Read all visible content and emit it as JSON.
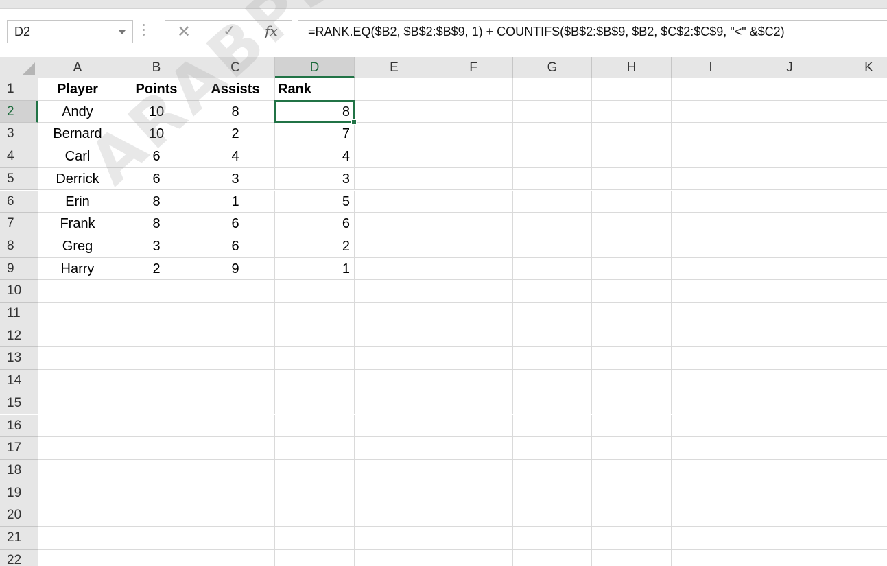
{
  "formula_bar": {
    "name_box": "D2",
    "cancel_icon": "close-icon",
    "enter_icon": "checkmark-icon",
    "fx_label": "fx",
    "formula": "=RANK.EQ($B2, $B$2:$B$9, 1) + COUNTIFS($B$2:$B$9, $B2, $C$2:$C$9, \"<\" &$C2)"
  },
  "grid": {
    "columns": [
      "A",
      "B",
      "C",
      "D",
      "E",
      "F",
      "G",
      "H",
      "I",
      "J",
      "K"
    ],
    "selected_column": "D",
    "selected_row": "2",
    "row_numbers": [
      "1",
      "2",
      "3",
      "4",
      "5",
      "6",
      "7",
      "8",
      "9",
      "10",
      "11",
      "12",
      "13",
      "14",
      "15",
      "16",
      "17",
      "18",
      "19",
      "20",
      "21",
      "22"
    ],
    "headers": {
      "A1": "Player",
      "B1": "Points",
      "C1": "Assists",
      "D1": "Rank"
    },
    "rows": [
      {
        "player": "Andy",
        "points": "10",
        "assists": "8",
        "rank": "8"
      },
      {
        "player": "Bernard",
        "points": "10",
        "assists": "2",
        "rank": "7"
      },
      {
        "player": "Carl",
        "points": "6",
        "assists": "4",
        "rank": "4"
      },
      {
        "player": "Derrick",
        "points": "6",
        "assists": "3",
        "rank": "3"
      },
      {
        "player": "Erin",
        "points": "8",
        "assists": "1",
        "rank": "5"
      },
      {
        "player": "Frank",
        "points": "8",
        "assists": "6",
        "rank": "6"
      },
      {
        "player": "Greg",
        "points": "3",
        "assists": "6",
        "rank": "2"
      },
      {
        "player": "Harry",
        "points": "2",
        "assists": "9",
        "rank": "1"
      }
    ]
  },
  "watermark": "ARABPSYCH",
  "colors": {
    "accent": "#217346",
    "header_bg": "#e6e6e6",
    "header_selected_bg": "#d2d2d2",
    "gridline": "#dadada"
  }
}
